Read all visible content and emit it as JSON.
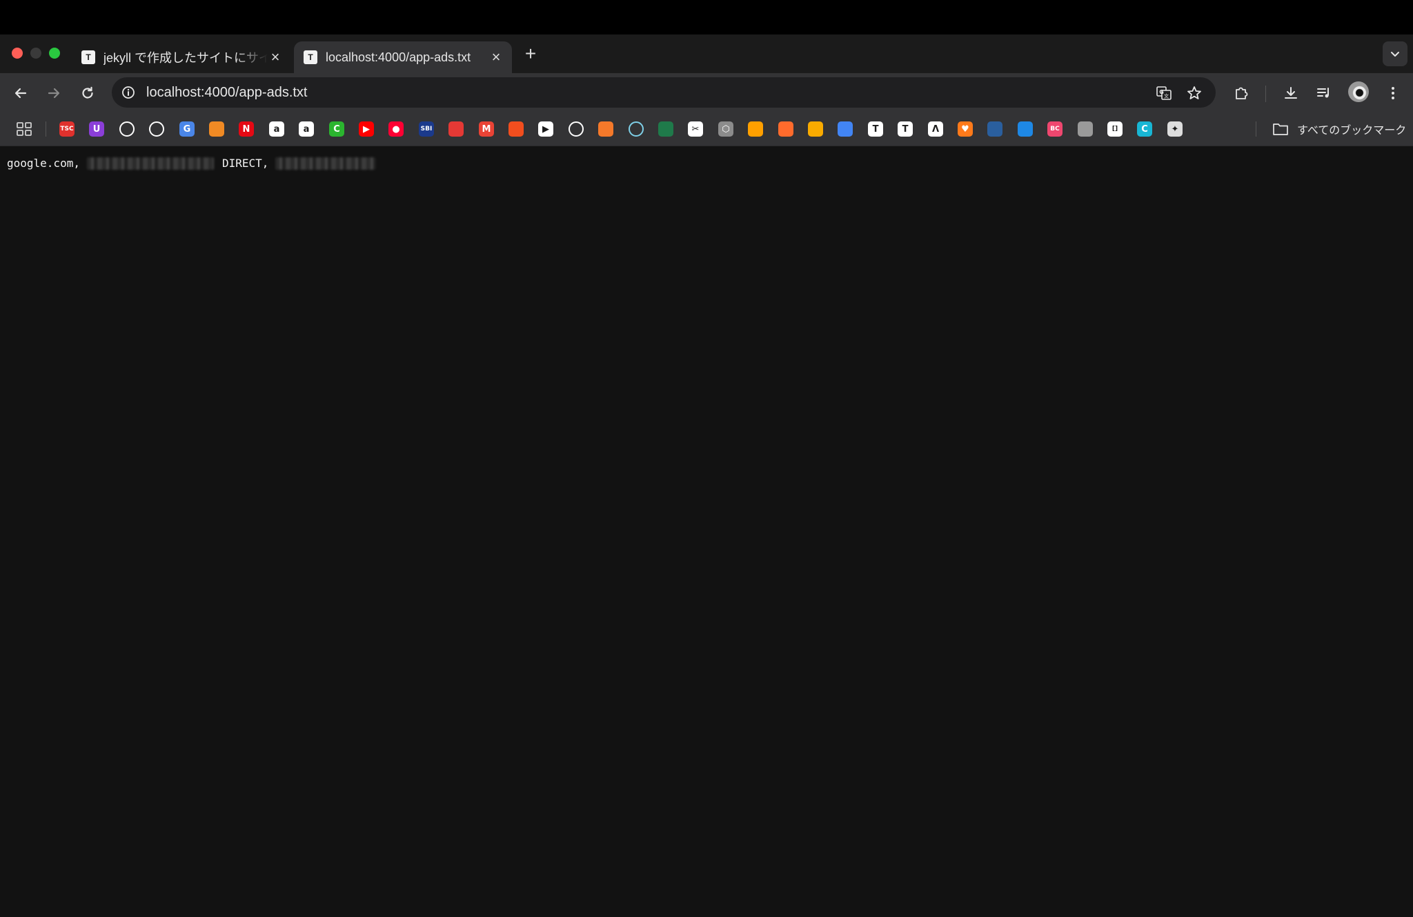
{
  "tabs": [
    {
      "title": "jekyll で作成したサイトにサイド",
      "favicon": "T",
      "active": false
    },
    {
      "title": "localhost:4000/app-ads.txt",
      "favicon": "T",
      "active": true
    }
  ],
  "omnibox": {
    "url": "localhost:4000/app-ads.txt"
  },
  "bookmarks_bar": {
    "folder_label": "すべてのブックマーク",
    "items": [
      {
        "icon": "bookmark-red-logo-icon",
        "color": "#e0312d",
        "text": "TSC"
      },
      {
        "icon": "bookmark-purple-u-icon",
        "color": "#8b3ed8",
        "text": "U"
      },
      {
        "icon": "github-icon",
        "color": "#ffffff",
        "text": ""
      },
      {
        "icon": "openai-icon",
        "color": "#ffffff",
        "text": ""
      },
      {
        "icon": "google-translate-icon",
        "color": "#4a86e8",
        "text": "G"
      },
      {
        "icon": "orange-box-icon",
        "color": "#f08a24",
        "text": ""
      },
      {
        "icon": "netflix-icon",
        "color": "#e50914",
        "text": "N"
      },
      {
        "icon": "amazon-icon",
        "color": "#ffffff",
        "text": "a"
      },
      {
        "icon": "amazon-alt-icon",
        "color": "#ffffff",
        "text": "a"
      },
      {
        "icon": "green-circle-icon",
        "color": "#2bb52f",
        "text": "C"
      },
      {
        "icon": "youtube-icon",
        "color": "#ff0000",
        "text": "▶"
      },
      {
        "icon": "youtube-music-icon",
        "color": "#ff0033",
        "text": "●"
      },
      {
        "icon": "sbi-icon",
        "color": "#1b3a8c",
        "text": "SBI"
      },
      {
        "icon": "red-blue-logo-icon",
        "color": "#e53935",
        "text": ""
      },
      {
        "icon": "gmail-icon",
        "color": "#ea4335",
        "text": "M"
      },
      {
        "icon": "figma-icon",
        "color": "#f24e1e",
        "text": ""
      },
      {
        "icon": "play-circle-icon",
        "color": "#ffffff",
        "text": "▶"
      },
      {
        "icon": "wing-icon",
        "color": "#ffffff",
        "text": ""
      },
      {
        "icon": "blender-icon",
        "color": "#f5792a",
        "text": ""
      },
      {
        "icon": "calendar-app-icon",
        "color": "#7fd0e8",
        "text": ""
      },
      {
        "icon": "green-pulse-icon",
        "color": "#1f7a4a",
        "text": ""
      },
      {
        "icon": "scissors-icon",
        "color": "#ffffff",
        "text": "✂"
      },
      {
        "icon": "gray-hex-icon",
        "color": "#8c8c8c",
        "text": "⬡"
      },
      {
        "icon": "firebase-icon",
        "color": "#ffa000",
        "text": ""
      },
      {
        "icon": "orange-ring-icon",
        "color": "#ff6b2c",
        "text": ""
      },
      {
        "icon": "analytics-icon",
        "color": "#f9ab00",
        "text": ""
      },
      {
        "icon": "google-ads-icon",
        "color": "#4285f4",
        "text": ""
      },
      {
        "icon": "t-white-icon",
        "color": "#ffffff",
        "text": "T"
      },
      {
        "icon": "t-white-alt-icon",
        "color": "#ffffff",
        "text": "T"
      },
      {
        "icon": "chevron-logo-icon",
        "color": "#ffffff",
        "text": "Λ"
      },
      {
        "icon": "orange-heart-icon",
        "color": "#ff7a1a",
        "text": "♥"
      },
      {
        "icon": "blue-square-icon",
        "color": "#2a5f9e",
        "text": ""
      },
      {
        "icon": "blue-swirl-icon",
        "color": "#1e88e5",
        "text": ""
      },
      {
        "icon": "pink-bc-icon",
        "color": "#ef476f",
        "text": "BC"
      },
      {
        "icon": "apple-icon",
        "color": "#9a9a9a",
        "text": ""
      },
      {
        "icon": "bracket-icon",
        "color": "#ffffff",
        "text": "[]"
      },
      {
        "icon": "canva-icon",
        "color": "#18b6d4",
        "text": "C"
      },
      {
        "icon": "spark-icon",
        "color": "#dddddd",
        "text": "✦"
      }
    ]
  },
  "content": {
    "text_prefix": "google.com,",
    "text_middle": "DIRECT,"
  }
}
